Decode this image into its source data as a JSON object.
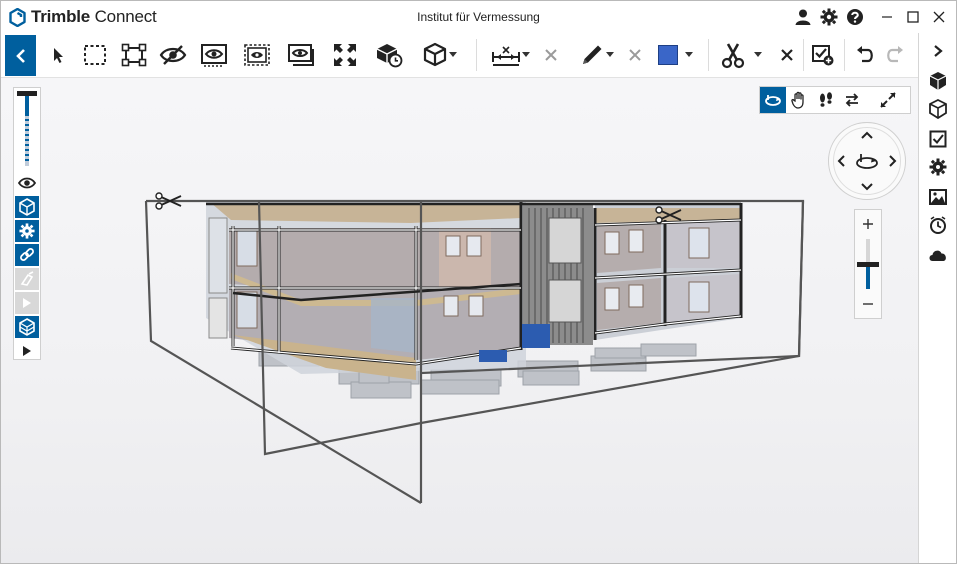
{
  "app": {
    "brand_bold": "Trimble",
    "brand_light": "Connect",
    "window_title": "Institut für Vermessung"
  },
  "title_actions": [
    "user-icon",
    "settings-icon",
    "help-icon",
    "minimize-icon",
    "maximize-icon",
    "close-icon"
  ],
  "toolbar": {
    "items": [
      "collapse-left",
      "select",
      "box-select",
      "fit-to-selection",
      "hide",
      "isolate",
      "show-all",
      "show-only",
      "fit-all",
      "orientation",
      "view-cube"
    ],
    "measure": "measure-tool",
    "markup": "pen-tool",
    "markup_color": "#3a66c8",
    "clip": "clip-tool",
    "undo": "undo",
    "redo": "redo"
  },
  "left_palette": [
    "visibility",
    "3d-box",
    "settings-gear",
    "link",
    "paint-disabled",
    "cursor-disabled",
    "layers-3d",
    "play"
  ],
  "nav_modes": [
    "orbit",
    "pan",
    "walk",
    "swap",
    "expand"
  ],
  "right_rail": [
    "collapse-right",
    "object-cube",
    "model-cube",
    "checklist",
    "gear",
    "image",
    "clock",
    "cloud"
  ],
  "colors": {
    "accent": "#005f9e",
    "viewport_bg": "#f3f3f5"
  }
}
